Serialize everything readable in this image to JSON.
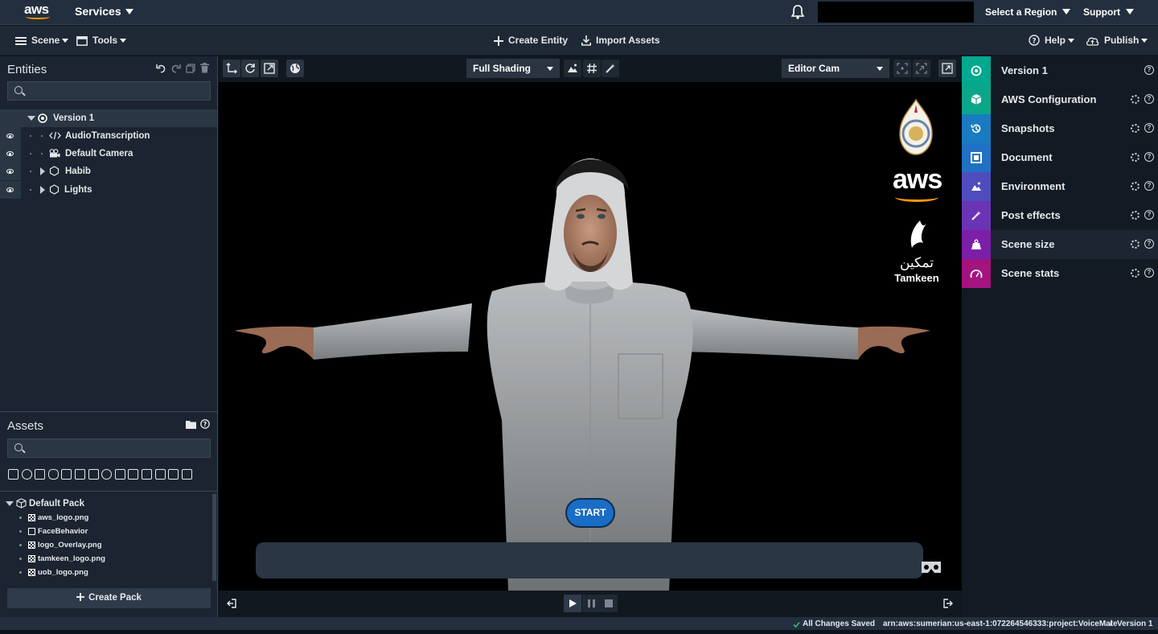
{
  "topbar": {
    "brand": "aws",
    "services_label": "Services",
    "region_label": "Select a Region",
    "support_label": "Support"
  },
  "menubar": {
    "scene_label": "Scene",
    "tools_label": "Tools",
    "create_entity_label": "Create Entity",
    "import_assets_label": "Import Assets",
    "help_label": "Help",
    "publish_label": "Publish"
  },
  "entities": {
    "title": "Entities",
    "search_placeholder": "",
    "root": "Version 1",
    "items": [
      {
        "label": "AudioTranscription",
        "icon": "script-icon"
      },
      {
        "label": "Default Camera",
        "icon": "camera-icon"
      },
      {
        "label": "Habib",
        "icon": "hexagon-icon"
      },
      {
        "label": "Lights",
        "icon": "hexagon-icon"
      }
    ]
  },
  "assets": {
    "title": "Assets",
    "search_placeholder": "",
    "pack": "Default Pack",
    "files": [
      "aws_logo.png",
      "FaceBehavior",
      "logo_Overlay.png",
      "tamkeen_logo.png",
      "uob_logo.png"
    ],
    "create_pack_label": "Create Pack"
  },
  "viewport": {
    "shading": "Full Shading",
    "camera": "Editor Cam",
    "start_label": "START",
    "logo_aws": "aws",
    "logo_tamkeen_ar": "تمكين",
    "logo_tamkeen_en": "Tamkeen"
  },
  "rightpanel": {
    "items": [
      {
        "label": "Version 1",
        "color": "#00a98f",
        "icon": "version-icon"
      },
      {
        "label": "AWS Configuration",
        "color": "#0ba68a",
        "icon": "box-icon"
      },
      {
        "label": "Snapshots",
        "color": "#1a7bc0",
        "icon": "history-icon"
      },
      {
        "label": "Document",
        "color": "#2071c4",
        "icon": "document-icon"
      },
      {
        "label": "Environment",
        "color": "#4f4dbd",
        "icon": "mountain-icon"
      },
      {
        "label": "Post effects",
        "color": "#6a34b5",
        "icon": "magic-wand-icon"
      },
      {
        "label": "Scene size",
        "color": "#7c1fa8",
        "icon": "weight-icon"
      },
      {
        "label": "Scene stats",
        "color": "#a3147e",
        "icon": "gauge-icon"
      }
    ]
  },
  "statusbar": {
    "saved": "All Changes Saved",
    "arn": "arn:aws:sumerian:us-east-1:072264546333:project:VoiceMate",
    "separator": "/",
    "version": "Version 1"
  }
}
